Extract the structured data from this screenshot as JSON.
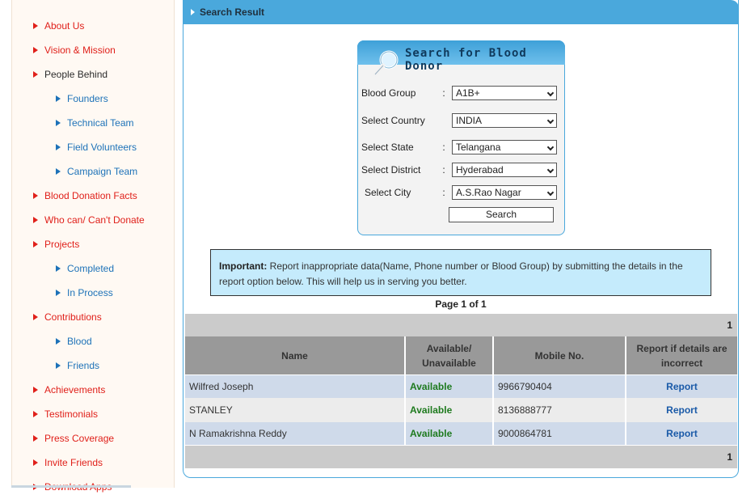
{
  "sidebar": {
    "items": [
      {
        "label": "About Us",
        "level": 1
      },
      {
        "label": "Vision & Mission",
        "level": 1
      },
      {
        "label": "People Behind",
        "level": 1
      },
      {
        "label": "Founders",
        "level": 2
      },
      {
        "label": "Technical Team",
        "level": 2
      },
      {
        "label": "Field Volunteers",
        "level": 2
      },
      {
        "label": "Campaign Team",
        "level": 2
      },
      {
        "label": "Blood Donation Facts",
        "level": 1
      },
      {
        "label": "Who can/ Can't Donate",
        "level": 1
      },
      {
        "label": "Projects",
        "level": 1
      },
      {
        "label": "Completed",
        "level": 2
      },
      {
        "label": "In Process",
        "level": 2
      },
      {
        "label": "Contributions",
        "level": 1
      },
      {
        "label": "Blood",
        "level": 2
      },
      {
        "label": "Friends",
        "level": 2
      },
      {
        "label": "Achievements",
        "level": 1
      },
      {
        "label": "Testimonials",
        "level": 1
      },
      {
        "label": "Press Coverage",
        "level": 1
      },
      {
        "label": "Invite Friends",
        "level": 1
      },
      {
        "label": "Download Apps",
        "level": 1
      }
    ]
  },
  "panel": {
    "title": "Search Result"
  },
  "search": {
    "title": "Search for Blood Donor",
    "fields": [
      {
        "label": "Blood Group",
        "colon": ":",
        "value": "A1B+"
      },
      {
        "label": "Select Country",
        "colon": "",
        "value": "INDIA"
      },
      {
        "label": "Select State",
        "colon": ":",
        "value": "Telangana"
      },
      {
        "label": "Select District",
        "colon": ":",
        "value": "Hyderabad"
      },
      {
        "label": "Select City",
        "colon": ":",
        "value": "A.S.Rao Nagar"
      }
    ],
    "button": "Search"
  },
  "notice": {
    "bold": "Important:",
    "text": " Report inappropriate data(Name, Phone number or Blood Group) by submitting the details in the report option below. This will help us in serving you better."
  },
  "pager": {
    "text": "Page 1 of 1",
    "page_number": "1"
  },
  "table": {
    "headers": [
      "Name",
      "Available/ Unavailable",
      "Mobile No.",
      "Report if details are incorrect"
    ],
    "rows": [
      {
        "name": "Wilfred Joseph",
        "status": "Available",
        "mobile": "9966790404",
        "action": "Report"
      },
      {
        "name": "STANLEY",
        "status": "Available",
        "mobile": "8136888777",
        "action": "Report"
      },
      {
        "name": "N Ramakrishna Reddy",
        "status": "Available",
        "mobile": "9000864781",
        "action": "Report"
      }
    ]
  },
  "colors": {
    "accent": "#4aa8dc",
    "nav_red": "#e0201a",
    "nav_blue": "#1d72b8",
    "available_green": "#1e7a1e",
    "notice_bg": "#c5ebfc"
  }
}
